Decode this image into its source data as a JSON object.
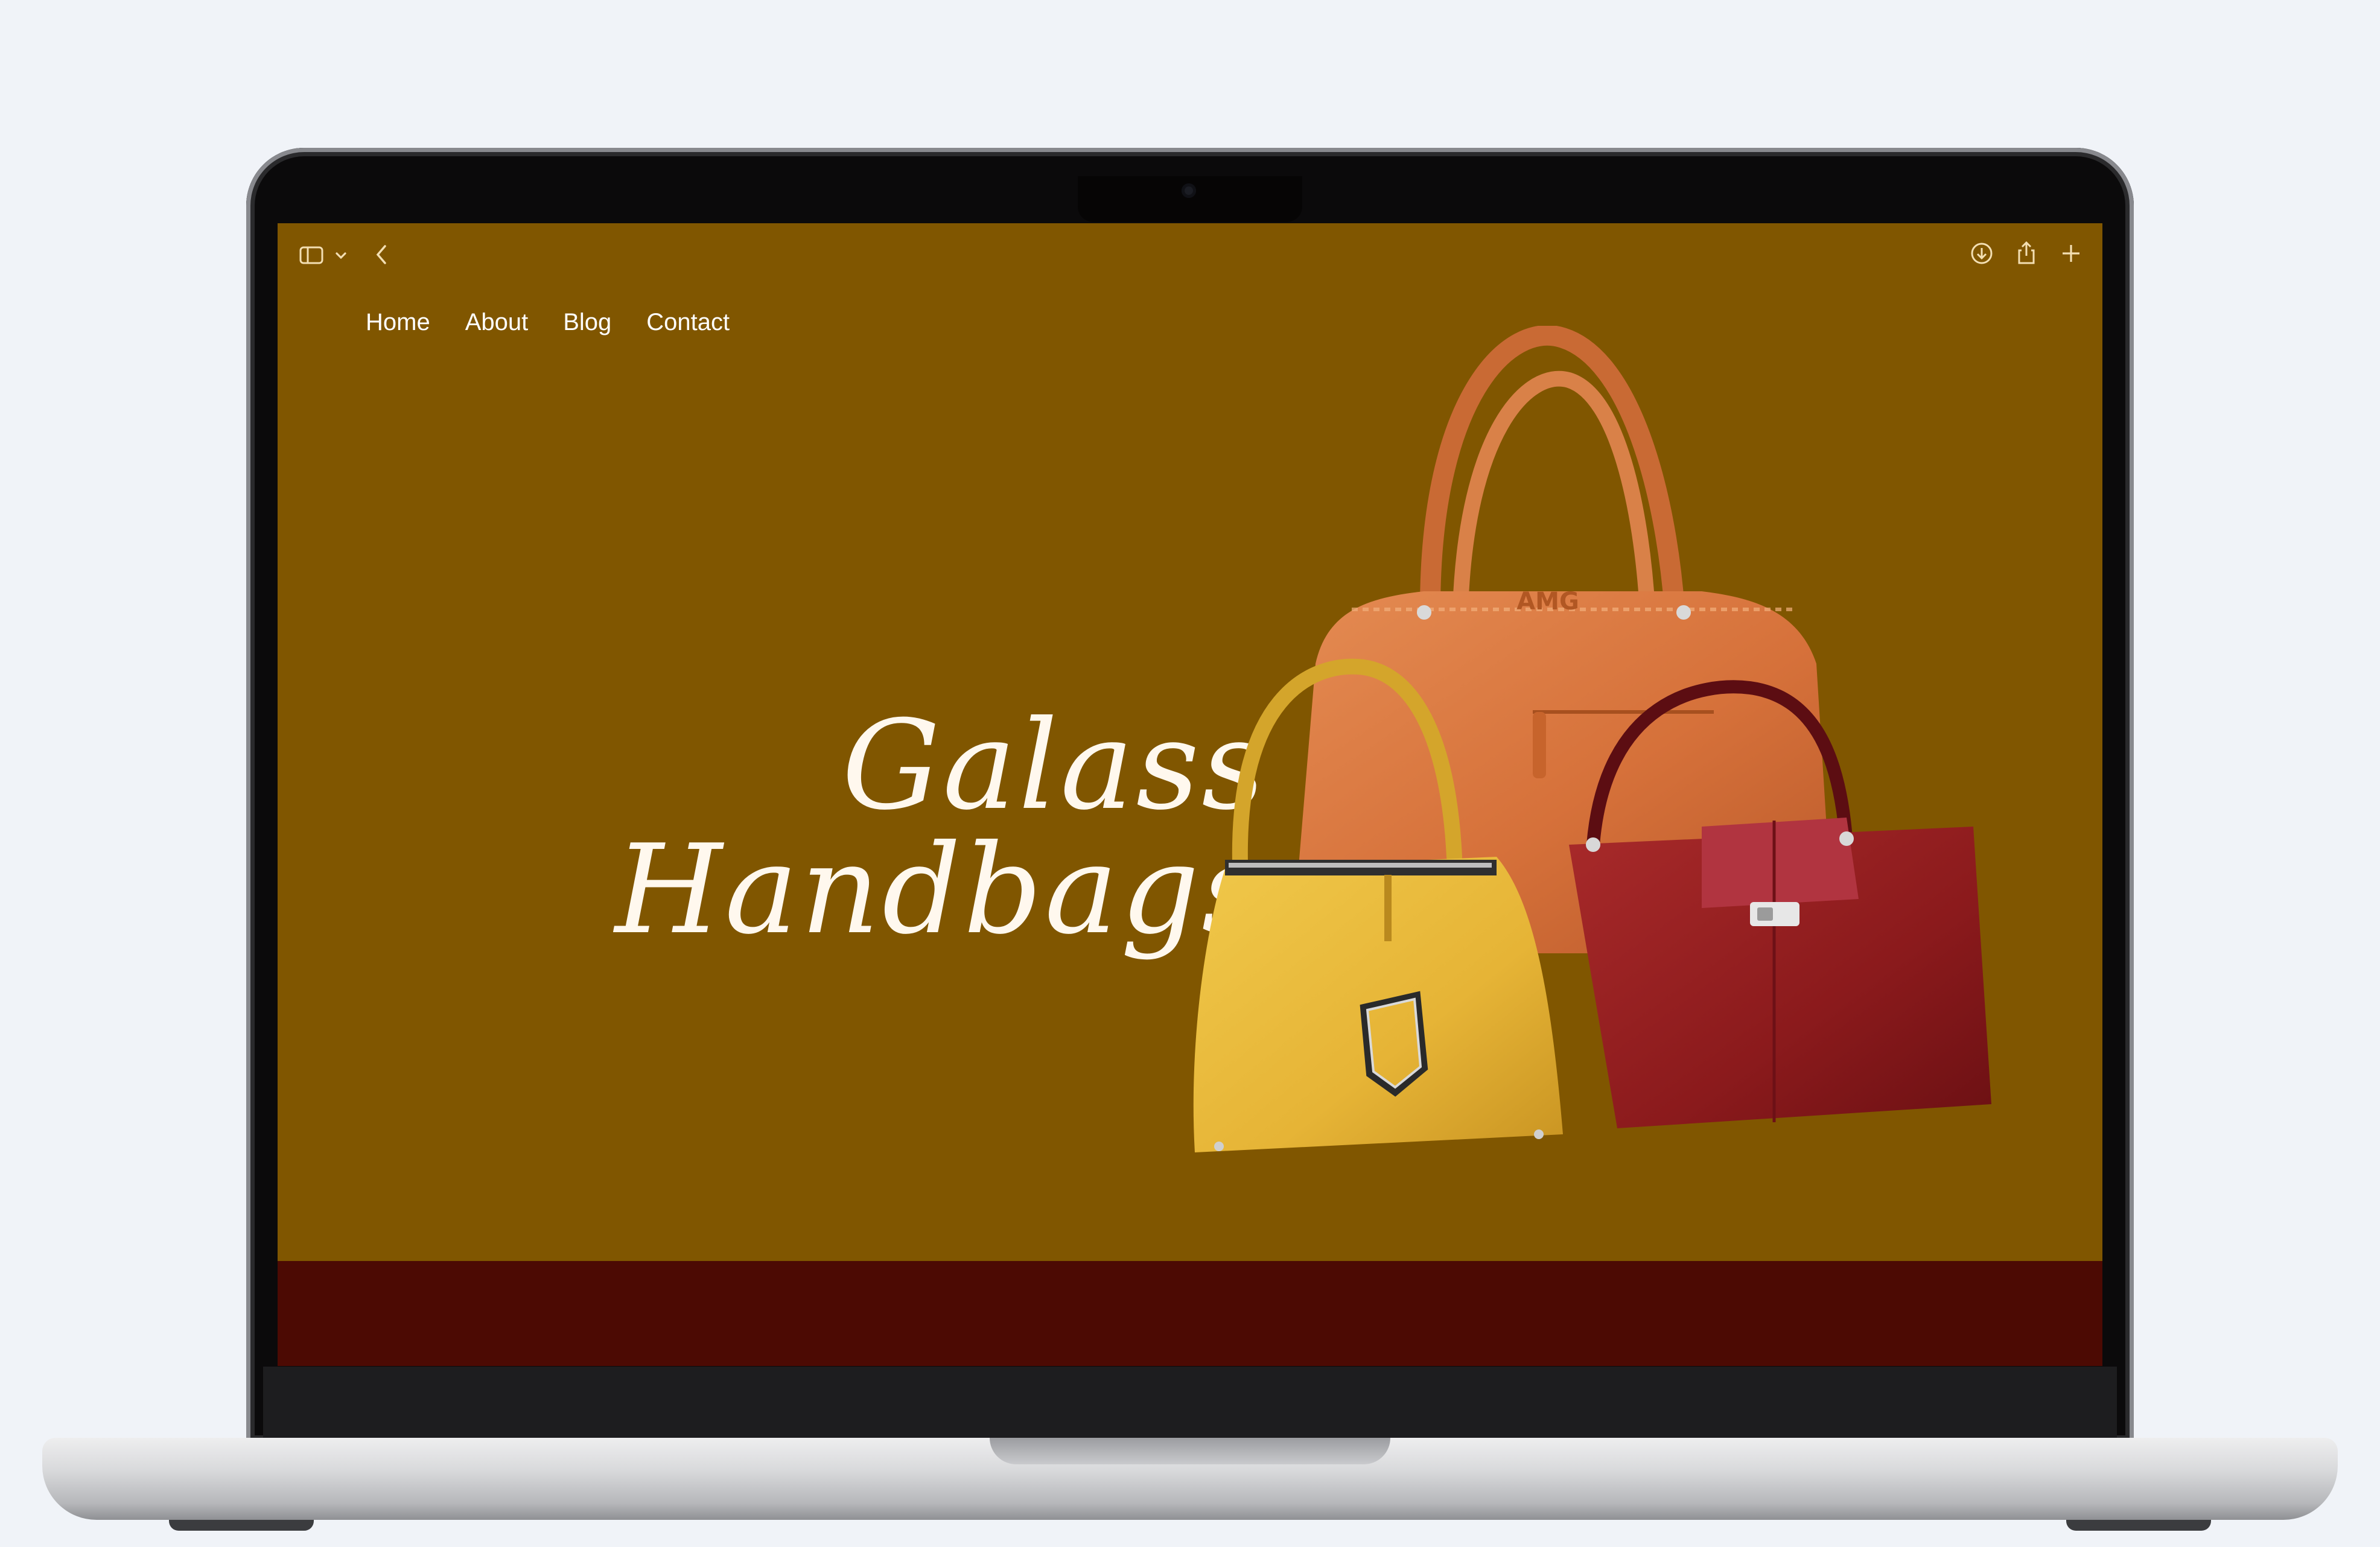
{
  "browser": {
    "icons": [
      "sidebar-icon",
      "chevron-down-icon",
      "back-icon",
      "download-icon",
      "share-icon",
      "new-tab-icon"
    ]
  },
  "nav": {
    "items": [
      "Home",
      "About",
      "Blog",
      "Contact"
    ]
  },
  "hero": {
    "title_line1": "Galass",
    "title_line2": "Handbags",
    "brand_tag": "AMG"
  },
  "colors": {
    "page_background": "#805600",
    "footer_band": "#4c0a03",
    "nav_text": "#ffffff",
    "title_text": "#fff8ee"
  }
}
